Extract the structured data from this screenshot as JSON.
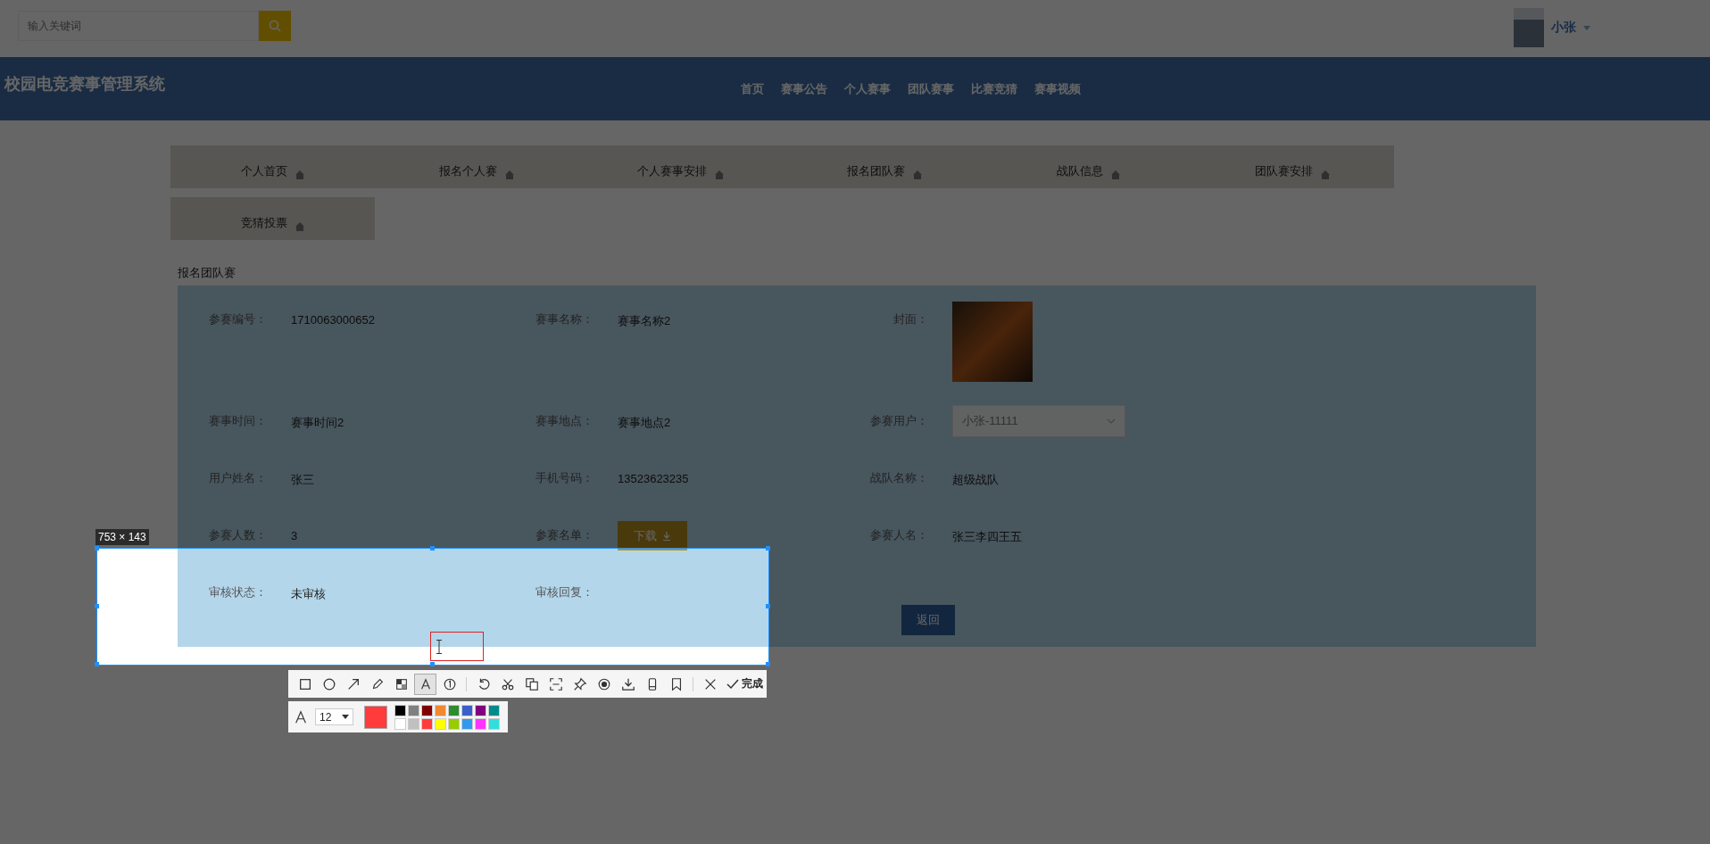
{
  "search": {
    "placeholder": "输入关键词"
  },
  "user": {
    "name": "小张"
  },
  "site_title": "校园电竞赛事管理系统",
  "nav": [
    "首页",
    "赛事公告",
    "个人赛事",
    "团队赛事",
    "比赛竞猜",
    "赛事视频"
  ],
  "tabs": [
    "个人首页",
    "报名个人赛",
    "个人赛事安排",
    "报名团队赛",
    "战队信息",
    "团队赛安排",
    "竞猜投票"
  ],
  "section_title": "报名团队赛",
  "form": {
    "fields": [
      {
        "kind": "text",
        "label": "参赛编号：",
        "value": "1710063000652"
      },
      {
        "kind": "text",
        "label": "赛事名称：",
        "value": "赛事名称2"
      },
      {
        "kind": "image",
        "label": "封面："
      },
      {
        "kind": "text",
        "label": "赛事时间：",
        "value": "赛事时间2"
      },
      {
        "kind": "text",
        "label": "赛事地点：",
        "value": "赛事地点2"
      },
      {
        "kind": "select",
        "label": "参赛用户：",
        "value": "小张-11111",
        "disabled": true
      },
      {
        "kind": "text",
        "label": "用户姓名：",
        "value": "张三"
      },
      {
        "kind": "text",
        "label": "手机号码：",
        "value": "13523623235"
      },
      {
        "kind": "text",
        "label": "战队名称：",
        "value": "超级战队"
      },
      {
        "kind": "text",
        "label": "参赛人数：",
        "value": "3"
      },
      {
        "kind": "button",
        "label": "参赛名单：",
        "value": "下载"
      },
      {
        "kind": "text",
        "label": "参赛人名：",
        "value": "张三李四王五"
      },
      {
        "kind": "text",
        "label": "审核状态：",
        "value": "未审核"
      },
      {
        "kind": "text",
        "label": "审核回复："
      }
    ],
    "back_button": "返回"
  },
  "screenshot_tool": {
    "size_label": "753 × 143",
    "tool_groups": [
      [
        {
          "kind": "rectangle",
          "selected": false
        },
        {
          "kind": "ellipse",
          "selected": false
        },
        {
          "kind": "arrow",
          "selected": false
        },
        {
          "kind": "pencil",
          "selected": false
        },
        {
          "kind": "mosaic",
          "selected": false
        },
        {
          "kind": "text",
          "selected": true
        },
        {
          "kind": "number",
          "selected": false
        }
      ],
      [
        {
          "kind": "undo",
          "selected": false
        },
        {
          "kind": "scissors",
          "selected": false
        },
        {
          "kind": "copy",
          "selected": false
        },
        {
          "kind": "scan",
          "selected": false
        },
        {
          "kind": "pin",
          "selected": false
        },
        {
          "kind": "record",
          "selected": false
        },
        {
          "kind": "download",
          "selected": false
        },
        {
          "kind": "phone",
          "selected": false
        },
        {
          "kind": "bookmark",
          "selected": false
        }
      ],
      [
        {
          "kind": "close",
          "selected": false
        }
      ]
    ],
    "done_label": "完成",
    "font_size": "12",
    "current": {
      "color": "#ff3b3b"
    },
    "palette": [
      {
        "color": "#000000"
      },
      {
        "color": "#808080"
      },
      {
        "color": "#800000"
      },
      {
        "color": "#f08a30"
      },
      {
        "color": "#2e8b2e"
      },
      {
        "color": "#3a5fcd"
      },
      {
        "color": "#800080"
      },
      {
        "color": "#008b8b"
      },
      {
        "color": "#ffffff"
      },
      {
        "color": "#c0c0c0"
      },
      {
        "color": "#ff3b3b"
      },
      {
        "color": "#ffff00"
      },
      {
        "color": "#99cc00"
      },
      {
        "color": "#3399ee"
      },
      {
        "color": "#ff33ff"
      },
      {
        "color": "#33dddd"
      }
    ]
  }
}
